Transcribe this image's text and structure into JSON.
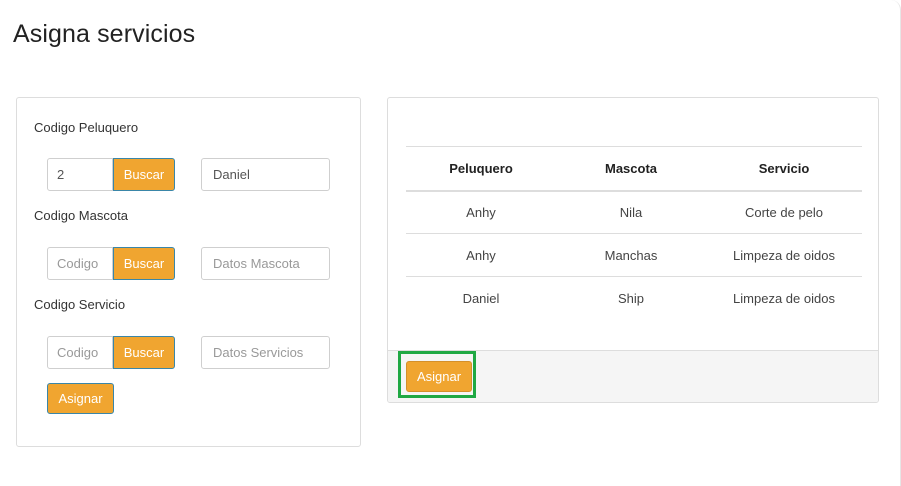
{
  "page": {
    "title": "Asigna servicios"
  },
  "form": {
    "peluquero": {
      "label": "Codigo Peluquero",
      "code_value": "2",
      "code_placeholder": "Codigo",
      "search_label": "Buscar",
      "info_value": "Daniel",
      "info_placeholder": ""
    },
    "mascota": {
      "label": "Codigo Mascota",
      "code_value": "",
      "code_placeholder": "Codigo",
      "search_label": "Buscar",
      "info_value": "",
      "info_placeholder": "Datos Mascota"
    },
    "servicio": {
      "label": "Codigo Servicio",
      "code_value": "",
      "code_placeholder": "Codigo",
      "search_label": "Buscar",
      "info_value": "",
      "info_placeholder": "Datos Servicios"
    },
    "assign_label": "Asignar"
  },
  "table": {
    "headers": [
      "Peluquero",
      "Mascota",
      "Servicio"
    ],
    "rows": [
      [
        "Anhy",
        "Nila",
        "Corte de pelo"
      ],
      [
        "Anhy",
        "Manchas",
        "Limpeza de oidos"
      ],
      [
        "Daniel",
        "Ship",
        "Limpeza de oidos"
      ]
    ]
  },
  "footer": {
    "assign_label": "Asignar"
  },
  "colors": {
    "accent": "#f0a530",
    "button_border": "#3a86a8",
    "highlight": "#1fa843"
  }
}
